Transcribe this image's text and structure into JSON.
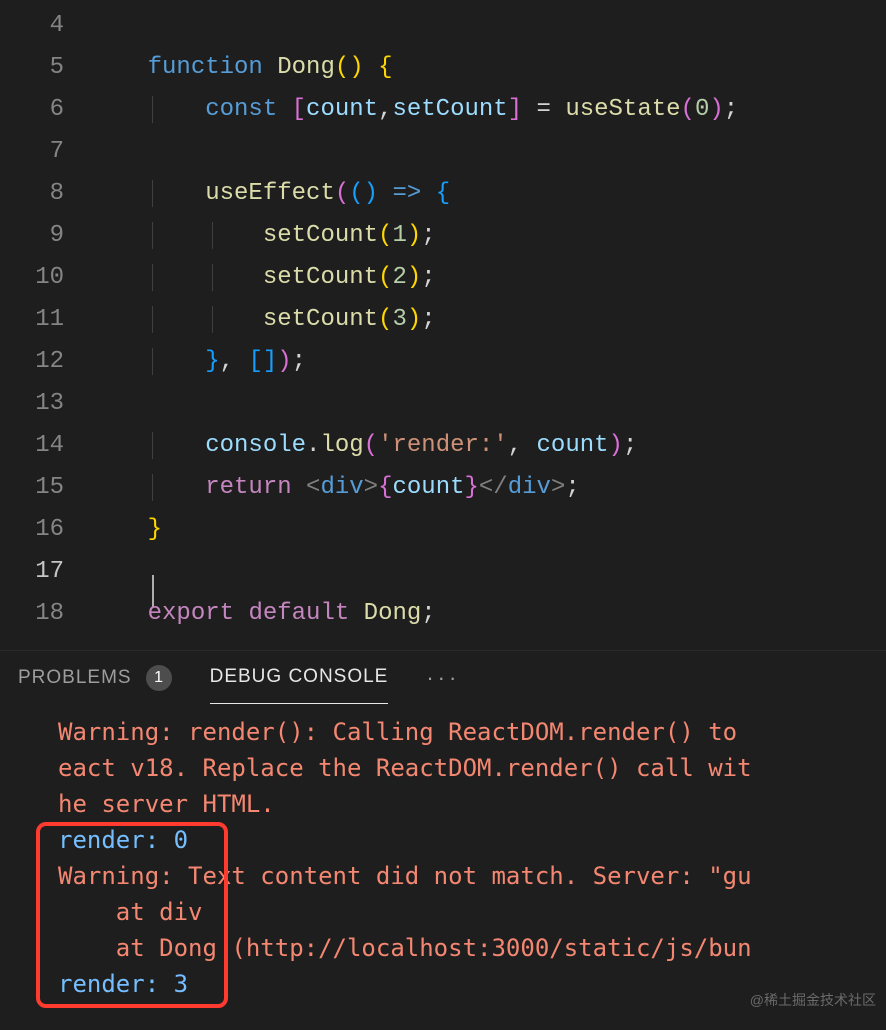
{
  "editor": {
    "lines": [
      {
        "n": 4,
        "tokens": []
      },
      {
        "n": 5,
        "tokens": [
          {
            "t": "    "
          },
          {
            "t": "function",
            "c": "tok-kw"
          },
          {
            "t": " "
          },
          {
            "t": "Dong",
            "c": "tok-fn"
          },
          {
            "t": "(",
            "c": "tok-brace"
          },
          {
            "t": ")",
            "c": "tok-brace"
          },
          {
            "t": " "
          },
          {
            "t": "{",
            "c": "tok-brace"
          }
        ]
      },
      {
        "n": 6,
        "tokens": [
          {
            "t": "        "
          },
          {
            "t": "const",
            "c": "tok-kw"
          },
          {
            "t": " "
          },
          {
            "t": "[",
            "c": "tok-brace2"
          },
          {
            "t": "count",
            "c": "tok-var"
          },
          {
            "t": ",",
            "c": "tok-punc"
          },
          {
            "t": "setCount",
            "c": "tok-var"
          },
          {
            "t": "]",
            "c": "tok-brace2"
          },
          {
            "t": " "
          },
          {
            "t": "=",
            "c": "tok-op"
          },
          {
            "t": " "
          },
          {
            "t": "useState",
            "c": "tok-fn"
          },
          {
            "t": "(",
            "c": "tok-brace2"
          },
          {
            "t": "0",
            "c": "tok-num"
          },
          {
            "t": ")",
            "c": "tok-brace2"
          },
          {
            "t": ";",
            "c": "tok-punc"
          }
        ]
      },
      {
        "n": 7,
        "tokens": []
      },
      {
        "n": 8,
        "tokens": [
          {
            "t": "        "
          },
          {
            "t": "useEffect",
            "c": "tok-fn"
          },
          {
            "t": "(",
            "c": "tok-brace2"
          },
          {
            "t": "(",
            "c": "tok-brace3"
          },
          {
            "t": ")",
            "c": "tok-brace3"
          },
          {
            "t": " "
          },
          {
            "t": "=>",
            "c": "tok-kw"
          },
          {
            "t": " "
          },
          {
            "t": "{",
            "c": "tok-brace3"
          }
        ]
      },
      {
        "n": 9,
        "tokens": [
          {
            "t": "            "
          },
          {
            "t": "setCount",
            "c": "tok-fn"
          },
          {
            "t": "(",
            "c": "tok-brace"
          },
          {
            "t": "1",
            "c": "tok-num"
          },
          {
            "t": ")",
            "c": "tok-brace"
          },
          {
            "t": ";",
            "c": "tok-punc"
          }
        ]
      },
      {
        "n": 10,
        "tokens": [
          {
            "t": "            "
          },
          {
            "t": "setCount",
            "c": "tok-fn"
          },
          {
            "t": "(",
            "c": "tok-brace"
          },
          {
            "t": "2",
            "c": "tok-num"
          },
          {
            "t": ")",
            "c": "tok-brace"
          },
          {
            "t": ";",
            "c": "tok-punc"
          }
        ]
      },
      {
        "n": 11,
        "tokens": [
          {
            "t": "            "
          },
          {
            "t": "setCount",
            "c": "tok-fn"
          },
          {
            "t": "(",
            "c": "tok-brace"
          },
          {
            "t": "3",
            "c": "tok-num"
          },
          {
            "t": ")",
            "c": "tok-brace"
          },
          {
            "t": ";",
            "c": "tok-punc"
          }
        ]
      },
      {
        "n": 12,
        "tokens": [
          {
            "t": "        "
          },
          {
            "t": "}",
            "c": "tok-brace3"
          },
          {
            "t": ", ",
            "c": "tok-punc"
          },
          {
            "t": "[",
            "c": "tok-brace3"
          },
          {
            "t": "]",
            "c": "tok-brace3"
          },
          {
            "t": ")",
            "c": "tok-brace2"
          },
          {
            "t": ";",
            "c": "tok-punc"
          }
        ]
      },
      {
        "n": 13,
        "tokens": []
      },
      {
        "n": 14,
        "tokens": [
          {
            "t": "        "
          },
          {
            "t": "console",
            "c": "tok-var"
          },
          {
            "t": ".",
            "c": "tok-punc"
          },
          {
            "t": "log",
            "c": "tok-fn"
          },
          {
            "t": "(",
            "c": "tok-brace2"
          },
          {
            "t": "'render:'",
            "c": "tok-str"
          },
          {
            "t": ", ",
            "c": "tok-punc"
          },
          {
            "t": "count",
            "c": "tok-var"
          },
          {
            "t": ")",
            "c": "tok-brace2"
          },
          {
            "t": ";",
            "c": "tok-punc"
          }
        ]
      },
      {
        "n": 15,
        "tokens": [
          {
            "t": "        "
          },
          {
            "t": "return",
            "c": "tok-kw2"
          },
          {
            "t": " "
          },
          {
            "t": "<",
            "c": "tok-tag"
          },
          {
            "t": "div",
            "c": "tok-tagname"
          },
          {
            "t": ">",
            "c": "tok-tag"
          },
          {
            "t": "{",
            "c": "tok-brace2"
          },
          {
            "t": "count",
            "c": "tok-var"
          },
          {
            "t": "}",
            "c": "tok-brace2"
          },
          {
            "t": "</",
            "c": "tok-tag"
          },
          {
            "t": "div",
            "c": "tok-tagname"
          },
          {
            "t": ">",
            "c": "tok-tag"
          },
          {
            "t": ";",
            "c": "tok-punc"
          }
        ]
      },
      {
        "n": 16,
        "tokens": [
          {
            "t": "    "
          },
          {
            "t": "}",
            "c": "tok-brace"
          }
        ]
      },
      {
        "n": 17,
        "active": true,
        "tokens": []
      },
      {
        "n": 18,
        "tokens": [
          {
            "t": "    "
          },
          {
            "t": "export",
            "c": "tok-kw2"
          },
          {
            "t": " "
          },
          {
            "t": "default",
            "c": "tok-kw2"
          },
          {
            "t": " "
          },
          {
            "t": "Dong",
            "c": "tok-fn"
          },
          {
            "t": ";",
            "c": "tok-punc"
          }
        ]
      }
    ]
  },
  "panel": {
    "tabs": {
      "problems": "PROBLEMS",
      "problems_badge": "1",
      "debug": "DEBUG CONSOLE"
    }
  },
  "console": {
    "lines": [
      {
        "cls": "con-warn",
        "txt": "Warning: render(): Calling ReactDOM.render() to "
      },
      {
        "cls": "con-warn",
        "txt": "eact v18. Replace the ReactDOM.render() call wit"
      },
      {
        "cls": "con-warn",
        "txt": "he server HTML."
      },
      {
        "cls": "con-log-key",
        "txt": "render: 0"
      },
      {
        "cls": "con-warn",
        "txt": "Warning: Text content did not match. Server: \"gu"
      },
      {
        "cls": "con-warn",
        "txt": "    at div",
        "indent": false
      },
      {
        "cls": "con-warn",
        "txt": "    at Dong (http://localhost:3000/static/js/bun",
        "indent": false
      },
      {
        "cls": "con-log-key",
        "txt": "render: 3"
      }
    ]
  },
  "watermark": "@稀土掘金技术社区"
}
